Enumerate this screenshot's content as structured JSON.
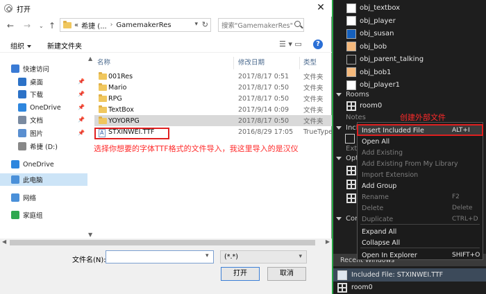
{
  "ide": {
    "objects": [
      {
        "name": "obj_textbox",
        "color": "#ffffff"
      },
      {
        "name": "obj_player",
        "color": "#ffffff"
      },
      {
        "name": "obj_susan",
        "color": "#1560bd"
      },
      {
        "name": "obj_bob",
        "color": "#f5b97c"
      },
      {
        "name": "obj_parent_talking",
        "color": "#1e1e1e"
      },
      {
        "name": "obj_bob1",
        "color": "#f5b97c"
      },
      {
        "name": "obj_player1",
        "color": "#ffffff"
      }
    ],
    "rooms_header": "Rooms",
    "room0": "room0",
    "notes_header": "Notes",
    "included_header": "Included Fi",
    "ext_header": "Exte",
    "opt_header": "Opti",
    "con_header": "Con",
    "recent_header": "Recent Windows",
    "bottom_items": [
      "Included File: STXINWEI.TTF",
      "room0"
    ]
  },
  "context_menu": {
    "items": [
      {
        "label": "Insert Included File",
        "shortcut": "ALT+I",
        "disabled": false
      },
      {
        "label": "Open All",
        "shortcut": "",
        "disabled": false
      },
      {
        "label": "Add Existing",
        "shortcut": "",
        "disabled": true
      },
      {
        "label": "Add Existing From My Library",
        "shortcut": "",
        "disabled": true
      },
      {
        "label": "Import Extension",
        "shortcut": "",
        "disabled": true
      },
      {
        "label": "Add Group",
        "shortcut": "",
        "disabled": false
      },
      {
        "label": "Rename",
        "shortcut": "F2",
        "disabled": true
      },
      {
        "label": "Delete",
        "shortcut": "Delete",
        "disabled": true
      },
      {
        "label": "Duplicate",
        "shortcut": "CTRL+D",
        "disabled": true
      },
      {
        "label": "Expand All",
        "shortcut": "",
        "disabled": false
      },
      {
        "label": "Collapse All",
        "shortcut": "",
        "disabled": false
      },
      {
        "label": "Open In Explorer",
        "shortcut": "SHIFT+O",
        "disabled": false
      }
    ]
  },
  "annotations": {
    "create_external": "创建外部文件",
    "select_font": "选择你想要的字体TTF格式的文件导入，我这里导入的是汉仪"
  },
  "dialog": {
    "title": "打开",
    "address": {
      "root": "«",
      "crumb1": "希捷 (...",
      "crumb2": "GamemakerRes"
    },
    "search_placeholder": "搜索\"GamemakerRes\"",
    "organize": "组织",
    "new_folder": "新建文件夹",
    "nav": [
      {
        "label": "快速访问",
        "color": "#3a7bd5"
      },
      {
        "label": "桌面",
        "color": "#2c72c7"
      },
      {
        "label": "下载",
        "color": "#2c72c7"
      },
      {
        "label": "OneDrive",
        "color": "#2e86de"
      },
      {
        "label": "文档",
        "color": "#7a8aa0"
      },
      {
        "label": "图片",
        "color": "#5a8fd0"
      },
      {
        "label": "希捷 (D:)",
        "color": "#888888"
      },
      {
        "label": "OneDrive",
        "color": "#2e86de"
      },
      {
        "label": "此电脑",
        "color": "#4a90d9"
      },
      {
        "label": "网络",
        "color": "#4a90d9"
      },
      {
        "label": "家庭组",
        "color": "#2fa84f"
      }
    ],
    "columns": {
      "name": "名称",
      "date": "修改日期",
      "type": "类型"
    },
    "files": [
      {
        "name": "001Res",
        "date": "2017/8/17 0:51",
        "type": "文件夹",
        "kind": "folder"
      },
      {
        "name": "Mario",
        "date": "2017/8/17 0:50",
        "type": "文件夹",
        "kind": "folder"
      },
      {
        "name": "RPG",
        "date": "2017/8/17 0:50",
        "type": "文件夹",
        "kind": "folder"
      },
      {
        "name": "TextBox",
        "date": "2017/9/14 0:09",
        "type": "文件夹",
        "kind": "folder"
      },
      {
        "name": "YOYORPG",
        "date": "2017/8/17 0:50",
        "type": "文件夹",
        "kind": "folder"
      },
      {
        "name": "STXINWEI.TTF",
        "date": "2016/8/29 17:05",
        "type": "TrueType",
        "kind": "font"
      }
    ],
    "filename_label": "文件名(N):",
    "filename_value": "",
    "filter_value": "(*.*)",
    "open_button": "打开",
    "cancel_button": "取消"
  }
}
